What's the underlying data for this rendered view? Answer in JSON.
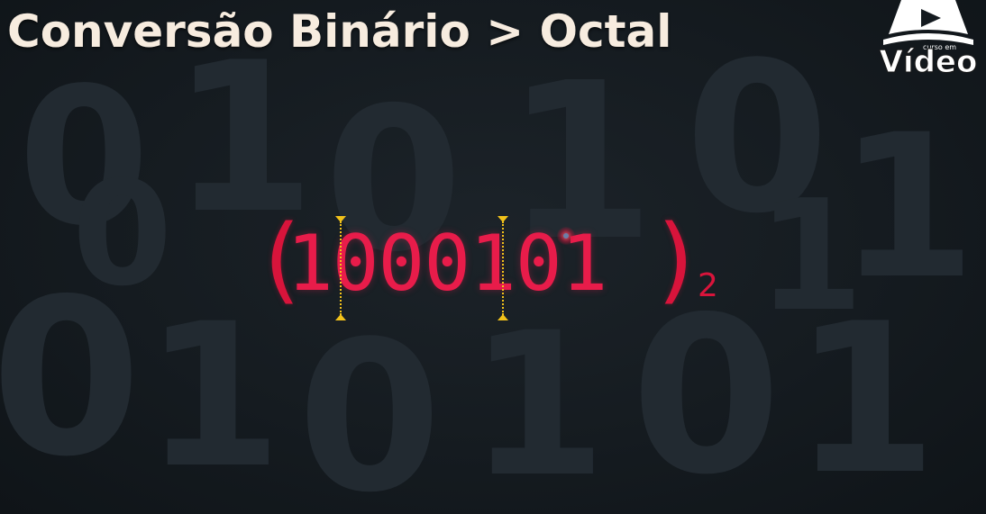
{
  "slide": {
    "title": "Conversão Binário > Octal"
  },
  "logo": {
    "small_text": "curso em",
    "word": "Vídeo",
    "icon": "play-book-icon"
  },
  "expression": {
    "open_paren": "(",
    "digits": "1000101",
    "close_paren": ")",
    "base": "2",
    "group_dividers": 2,
    "groups": [
      "1",
      "000",
      "101"
    ]
  },
  "background": {
    "digits": [
      "0",
      "1",
      "0",
      "1",
      "0",
      "1",
      "0",
      "1",
      "0",
      "1",
      "0",
      "1",
      "0",
      "1"
    ]
  },
  "colors": {
    "title": "#f7ecdf",
    "digits": "#e81c4a",
    "divider": "#f2c21a",
    "background": "#141a1f"
  }
}
